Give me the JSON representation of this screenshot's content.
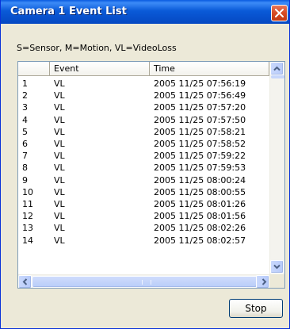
{
  "window": {
    "title": "Camera 1  Event List"
  },
  "legend": "S=Sensor, M=Motion, VL=VideoLoss",
  "table": {
    "columns": [
      "",
      "Event",
      "Time"
    ],
    "rows": [
      [
        "1",
        "VL",
        "2005 11/25 07:56:19"
      ],
      [
        "2",
        "VL",
        "2005 11/25 07:56:49"
      ],
      [
        "3",
        "VL",
        "2005 11/25 07:57:20"
      ],
      [
        "4",
        "VL",
        "2005 11/25 07:57:50"
      ],
      [
        "5",
        "VL",
        "2005 11/25 07:58:21"
      ],
      [
        "6",
        "VL",
        "2005 11/25 07:58:52"
      ],
      [
        "7",
        "VL",
        "2005 11/25 07:59:22"
      ],
      [
        "8",
        "VL",
        "2005 11/25 07:59:53"
      ],
      [
        "9",
        "VL",
        "2005 11/25 08:00:24"
      ],
      [
        "10",
        "VL",
        "2005 11/25 08:00:55"
      ],
      [
        "11",
        "VL",
        "2005 11/25 08:01:26"
      ],
      [
        "12",
        "VL",
        "2005 11/25 08:01:56"
      ],
      [
        "13",
        "VL",
        "2005 11/25 08:02:26"
      ],
      [
        "14",
        "VL",
        "2005 11/25 08:02:57"
      ]
    ]
  },
  "buttons": {
    "stop": "Stop"
  },
  "icons": {
    "close": "close-icon",
    "scroll_up": "scroll-up-arrow-icon",
    "scroll_down": "scroll-down-arrow-icon",
    "scroll_left": "scroll-left-arrow-icon",
    "scroll_right": "scroll-right-arrow-icon"
  },
  "colors": {
    "titlebar": "#0a5ad8",
    "close_button": "#d64b24",
    "dialog_background": "#ece9d8",
    "scrollbar_accent": "#b6cafa"
  }
}
